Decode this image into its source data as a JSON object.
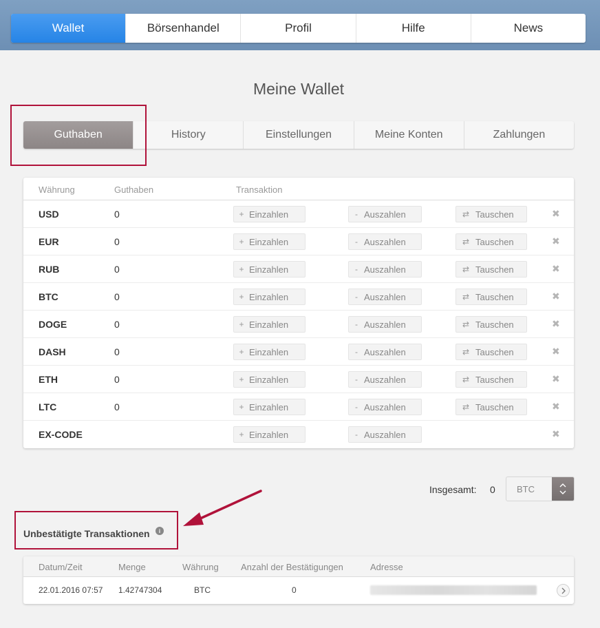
{
  "top_nav": [
    {
      "label": "Wallet",
      "active": true
    },
    {
      "label": "Börsenhandel",
      "active": false
    },
    {
      "label": "Profil",
      "active": false
    },
    {
      "label": "Hilfe",
      "active": false
    },
    {
      "label": "News",
      "active": false
    }
  ],
  "page_title": "Meine Wallet",
  "sub_nav": [
    {
      "label": "Guthaben",
      "active": true
    },
    {
      "label": "History",
      "active": false
    },
    {
      "label": "Einstellungen",
      "active": false
    },
    {
      "label": "Meine Konten",
      "active": false
    },
    {
      "label": "Zahlungen",
      "active": false
    }
  ],
  "wallet_table": {
    "headers": {
      "currency": "Währung",
      "balance": "Guthaben",
      "transaction": "Transaktion"
    },
    "deposit_label": "Einzahlen",
    "withdraw_label": "Auszahlen",
    "exchange_label": "Tauschen",
    "deposit_icon": "+",
    "withdraw_icon": "-",
    "exchange_icon": "⇄",
    "remove_icon": "✖",
    "rows": [
      {
        "currency": "USD",
        "balance": "0",
        "exchange": true
      },
      {
        "currency": "EUR",
        "balance": "0",
        "exchange": true
      },
      {
        "currency": "RUB",
        "balance": "0",
        "exchange": true
      },
      {
        "currency": "BTC",
        "balance": "0",
        "exchange": true
      },
      {
        "currency": "DOGE",
        "balance": "0",
        "exchange": true
      },
      {
        "currency": "DASH",
        "balance": "0",
        "exchange": true
      },
      {
        "currency": "ETH",
        "balance": "0",
        "exchange": true
      },
      {
        "currency": "LTC",
        "balance": "0",
        "exchange": true
      },
      {
        "currency": "EX-CODE",
        "balance": "",
        "exchange": false
      }
    ]
  },
  "total": {
    "label": "Insgesamt:",
    "value": "0",
    "currency": "BTC"
  },
  "pending": {
    "title": "Unbestätigte Transaktionen",
    "info_icon": "i",
    "headers": {
      "date": "Datum/Zeit",
      "amount": "Menge",
      "currency": "Währung",
      "confirmations": "Anzahl der Bestätigungen",
      "address": "Adresse"
    },
    "rows": [
      {
        "date": "22.01.2016 07:57",
        "amount": "1.42747304",
        "currency": "BTC",
        "confirmations": "0"
      }
    ]
  },
  "colors": {
    "accent": "#2684e6",
    "annotation": "#b0123a",
    "active_subtab": "#8c8585"
  }
}
